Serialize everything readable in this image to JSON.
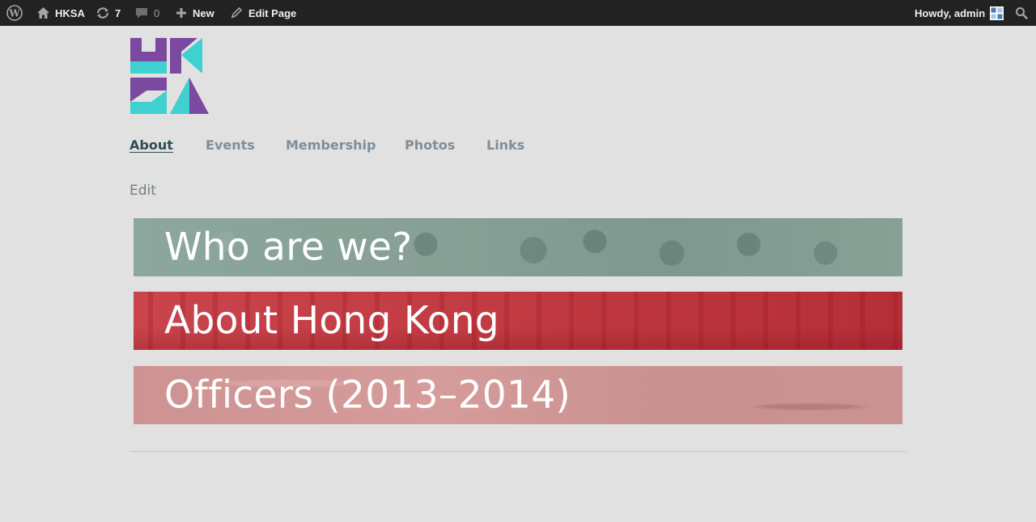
{
  "adminbar": {
    "site_name": "HKSA",
    "updates_count": "7",
    "comments_count": "0",
    "new_label": "New",
    "edit_page_label": "Edit Page",
    "howdy_label": "Howdy, admin"
  },
  "nav": {
    "items": [
      {
        "label": "About",
        "active": true
      },
      {
        "label": "Events"
      },
      {
        "label": "Membership"
      },
      {
        "label": "Photos"
      },
      {
        "label": "Links"
      }
    ]
  },
  "edit_link": "Edit",
  "banners": [
    {
      "title": "Who are we?"
    },
    {
      "title": "About Hong Kong"
    },
    {
      "title": "Officers (2013–2014)"
    }
  ],
  "colors": {
    "logo_purple": "#7b4aa0",
    "logo_cyan": "#3fd0d0",
    "nav_active": "#2f4d57",
    "nav_inactive": "#7f8e99",
    "adminbar_bg": "#222222",
    "page_bg": "#e1e1e1"
  }
}
